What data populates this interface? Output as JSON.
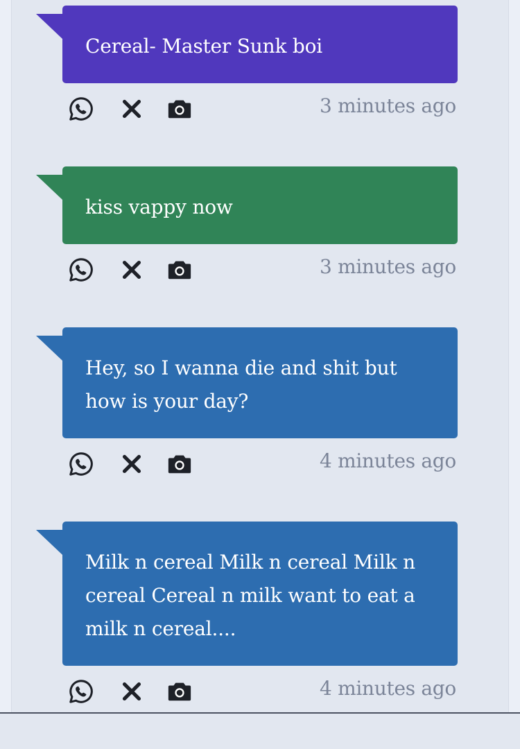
{
  "colors": {
    "purple": "#5038bd",
    "green": "#308457",
    "blue": "#2d6db0",
    "time": "#7b8498",
    "icon": "#1e2128"
  },
  "messages": [
    {
      "text": "Cereal- Master Sunk boi",
      "time": "3 minutes ago",
      "color": "#5038bd"
    },
    {
      "text": "kiss vappy now",
      "time": "3 minutes ago",
      "color": "#308457"
    },
    {
      "text": "Hey, so I wanna die and shit but how is your day?",
      "time": "4 minutes ago",
      "color": "#2d6db0"
    },
    {
      "text": "Milk n cereal Milk n cereal Milk n cereal Cereal n milk want to eat a milk n cereal....",
      "time": "4 minutes ago",
      "color": "#2d6db0"
    }
  ],
  "icons": {
    "share": "whatsapp-icon",
    "remove": "close-icon",
    "screenshot": "camera-icon"
  }
}
